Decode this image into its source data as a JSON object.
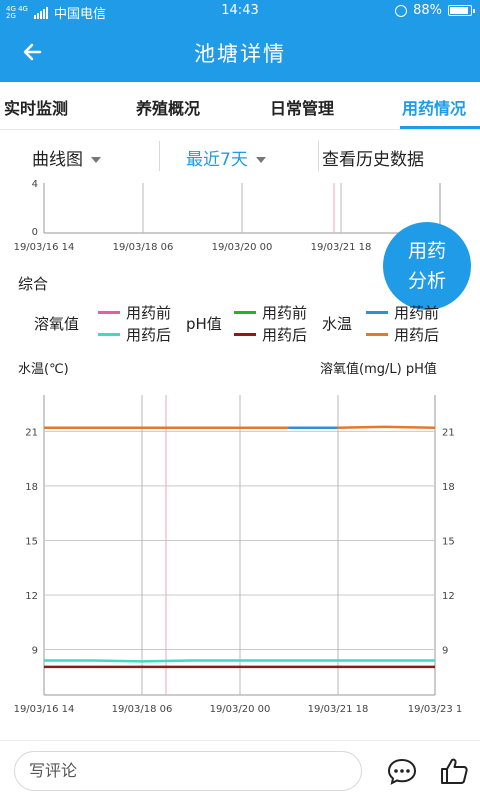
{
  "status_bar": {
    "network_tag": "4G 4G",
    "network_tag2": "2G",
    "carrier": "中国电信",
    "time": "14:43",
    "battery": "88%",
    "battery_level": 0.88
  },
  "app_bar": {
    "title": "池塘详情",
    "back_icon": "arrow-left-icon"
  },
  "tabs": [
    {
      "label": "实时监测",
      "active": false
    },
    {
      "label": "养殖概况",
      "active": false
    },
    {
      "label": "日常管理",
      "active": false
    },
    {
      "label": "用药情况",
      "active": true
    }
  ],
  "filters": {
    "chart_type": "曲线图",
    "range": "最近7天",
    "history_link": "查看历史数据"
  },
  "fab": {
    "line1": "用药",
    "line2": "分析"
  },
  "section_label": "综合",
  "legend": {
    "groups": [
      {
        "name": "溶氧值",
        "before": "用药前",
        "after": "用药后",
        "before_color": "#e8609a",
        "after_color": "#3fd9c6"
      },
      {
        "name": "pH值",
        "before": "用药前",
        "after": "用药后",
        "before_color": "#1fb52a",
        "after_color": "#8b1a1a"
      },
      {
        "name": "水温",
        "before": "用药前",
        "after": "用药后",
        "before_color": "#2f8fd8",
        "after_color": "#e07a2e"
      }
    ]
  },
  "axis_titles": {
    "left": "水温(℃)",
    "right": "溶氧值(mg/L)  pH值"
  },
  "comment": {
    "placeholder": "写评论",
    "comment_icon": "chat-bubble-icon",
    "like_icon": "thumbs-up-icon"
  },
  "chart_data": [
    {
      "type": "line",
      "x_tick_labels": [
        "19/03/16 14",
        "19/03/18 06",
        "19/03/20 00",
        "19/03/21 18"
      ],
      "y_tick_labels": [
        "4",
        "0"
      ],
      "ylim": [
        0,
        4
      ],
      "series": []
    },
    {
      "type": "line",
      "x_tick_labels": [
        "19/03/16 14",
        "19/03/18 06",
        "19/03/20 00",
        "19/03/21 18",
        "19/03/23 1"
      ],
      "y_left_ticks": [
        9,
        12,
        15,
        18,
        21
      ],
      "y_right_ticks": [
        9,
        12,
        15,
        18,
        21
      ],
      "ylim": [
        6.5,
        23
      ],
      "xlabel": "",
      "series": [
        {
          "name": "水温 用药后",
          "color": "#e07a2e",
          "values": [
            21.2,
            21.2,
            21.2,
            21.2,
            21.2,
            21.2,
            21.2,
            21.25,
            21.2
          ]
        },
        {
          "name": "水温 用药前",
          "color": "#2f8fd8",
          "values": [
            null,
            null,
            null,
            null,
            null,
            21.2,
            21.2,
            null,
            null
          ]
        },
        {
          "name": "溶氧值 用药后",
          "color": "#3fd9c6",
          "values": [
            8.4,
            8.4,
            8.35,
            8.4,
            8.4,
            8.4,
            8.4,
            8.4,
            8.4
          ]
        },
        {
          "name": "pH值 用药后",
          "color": "#8b1a1a",
          "values": [
            8.05,
            8.05,
            8.05,
            8.05,
            8.05,
            8.05,
            8.05,
            8.05,
            8.05
          ]
        }
      ]
    }
  ]
}
